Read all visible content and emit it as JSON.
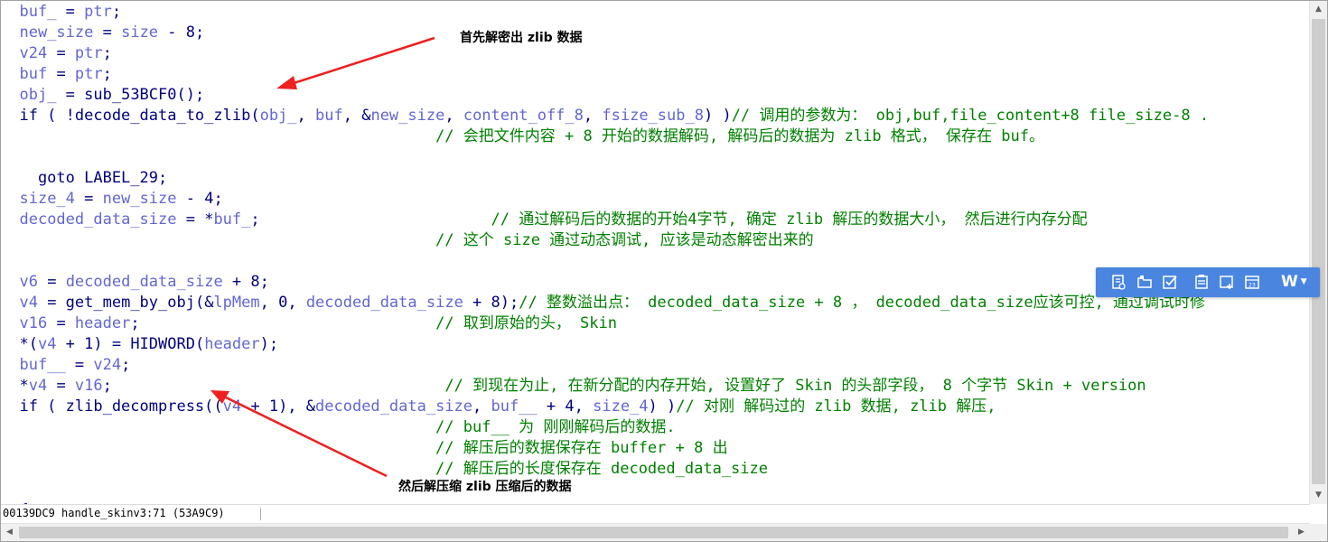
{
  "code_lines": [
    [
      {
        "t": "  "
      },
      {
        "t": "buf_",
        "c": "v"
      },
      {
        "t": " = "
      },
      {
        "t": "ptr",
        "c": "v"
      },
      {
        "t": ";"
      }
    ],
    [
      {
        "t": "  "
      },
      {
        "t": "new_size",
        "c": "v"
      },
      {
        "t": " = "
      },
      {
        "t": "size",
        "c": "v"
      },
      {
        "t": " - 8;"
      }
    ],
    [
      {
        "t": "  "
      },
      {
        "t": "v24",
        "c": "v"
      },
      {
        "t": " = "
      },
      {
        "t": "ptr",
        "c": "v"
      },
      {
        "t": ";"
      }
    ],
    [
      {
        "t": "  "
      },
      {
        "t": "buf",
        "c": "v"
      },
      {
        "t": " = "
      },
      {
        "t": "ptr",
        "c": "v"
      },
      {
        "t": ";"
      }
    ],
    [
      {
        "t": "  "
      },
      {
        "t": "obj_",
        "c": "v"
      },
      {
        "t": " = sub_53BCF0();"
      }
    ],
    [
      {
        "t": "  if ( !decode_data_to_zlib("
      },
      {
        "t": "obj_",
        "c": "v"
      },
      {
        "t": ", "
      },
      {
        "t": "buf",
        "c": "v"
      },
      {
        "t": ", &"
      },
      {
        "t": "new_size",
        "c": "v"
      },
      {
        "t": ", "
      },
      {
        "t": "content_off_8",
        "c": "v"
      },
      {
        "t": ", "
      },
      {
        "t": "fsize_sub_8",
        "c": "v"
      },
      {
        "t": ") )"
      },
      {
        "t": "// 调用的参数为： obj,buf,file_content+8 file_size-8 .",
        "c": "c"
      }
    ],
    [
      {
        "t": "                                               "
      },
      {
        "t": "// 会把文件内容 + 8 开始的数据解码, 解码后的数据为 zlib 格式， 保存在 buf。",
        "c": "c"
      }
    ],
    [
      {
        "t": ""
      }
    ],
    [
      {
        "t": "    goto LABEL_29;"
      }
    ],
    [
      {
        "t": "  "
      },
      {
        "t": "size_4",
        "c": "v"
      },
      {
        "t": " = "
      },
      {
        "t": "new_size",
        "c": "v"
      },
      {
        "t": " - 4;"
      }
    ],
    [
      {
        "t": "  "
      },
      {
        "t": "decoded_data_size",
        "c": "v"
      },
      {
        "t": " = *"
      },
      {
        "t": "buf_",
        "c": "v"
      },
      {
        "t": ";"
      },
      {
        "t": "                         "
      },
      {
        "t": "// 通过解码后的数据的开始4字节, 确定 zlib 解压的数据大小， 然后进行内存分配",
        "c": "c"
      }
    ],
    [
      {
        "t": "                                               "
      },
      {
        "t": "// 这个 size 通过动态调试, 应该是动态解密出来的",
        "c": "c"
      }
    ],
    [
      {
        "t": ""
      }
    ],
    [
      {
        "t": "  "
      },
      {
        "t": "v6",
        "c": "v"
      },
      {
        "t": " = "
      },
      {
        "t": "decoded_data_size",
        "c": "v"
      },
      {
        "t": " + 8;"
      }
    ],
    [
      {
        "t": "  "
      },
      {
        "t": "v4",
        "c": "v"
      },
      {
        "t": " = get_mem_by_obj(&"
      },
      {
        "t": "lpMem",
        "c": "v"
      },
      {
        "t": ", 0, "
      },
      {
        "t": "decoded_data_size",
        "c": "v"
      },
      {
        "t": " + 8);"
      },
      {
        "t": "// 整数溢出点： decoded_data_size + 8 ， decoded_data_size应该可控, 通过调试时修",
        "c": "c"
      }
    ],
    [
      {
        "t": "  "
      },
      {
        "t": "v16",
        "c": "v"
      },
      {
        "t": " = "
      },
      {
        "t": "header",
        "c": "v"
      },
      {
        "t": ";"
      },
      {
        "t": "                                "
      },
      {
        "t": "// 取到原始的头， Skin",
        "c": "c"
      }
    ],
    [
      {
        "t": "  *("
      },
      {
        "t": "v4",
        "c": "v"
      },
      {
        "t": " + 1) = HIDWORD("
      },
      {
        "t": "header",
        "c": "v"
      },
      {
        "t": ");"
      }
    ],
    [
      {
        "t": "  "
      },
      {
        "t": "buf__",
        "c": "v"
      },
      {
        "t": " = "
      },
      {
        "t": "v24",
        "c": "v"
      },
      {
        "t": ";"
      }
    ],
    [
      {
        "t": "  *"
      },
      {
        "t": "v4",
        "c": "v"
      },
      {
        "t": " = "
      },
      {
        "t": "v16",
        "c": "v"
      },
      {
        "t": ";"
      },
      {
        "t": "                                    "
      },
      {
        "t": "// 到现在为止, 在新分配的内存开始, 设置好了 Skin 的头部字段， 8 个字节 Skin + version",
        "c": "c"
      }
    ],
    [
      {
        "t": "  if ( zlib_decompress(("
      },
      {
        "t": "v4",
        "c": "v"
      },
      {
        "t": " + 1), &"
      },
      {
        "t": "decoded_data_size",
        "c": "v"
      },
      {
        "t": ", "
      },
      {
        "t": "buf__",
        "c": "v"
      },
      {
        "t": " + 4, "
      },
      {
        "t": "size_4",
        "c": "v"
      },
      {
        "t": ") )"
      },
      {
        "t": "// 对刚 解码过的 zlib 数据, zlib 解压,",
        "c": "c"
      }
    ],
    [
      {
        "t": "                                               "
      },
      {
        "t": "// buf__ 为 刚刚解码后的数据.",
        "c": "c"
      }
    ],
    [
      {
        "t": "                                               "
      },
      {
        "t": "// 解压后的数据保存在 buffer + 8 出",
        "c": "c"
      }
    ],
    [
      {
        "t": "                                               "
      },
      {
        "t": "// 解压后的长度保存在 decoded_data_size",
        "c": "c"
      }
    ],
    [
      {
        "t": ""
      }
    ],
    [
      {
        "t": "  {"
      }
    ],
    [
      {
        "t": "LABEL_29:"
      }
    ],
    [
      {
        "t": "    sub_482C20(&"
      },
      {
        "t": "obj",
        "c": "v"
      },
      {
        "t": ");"
      }
    ]
  ],
  "annotations": {
    "top": "首先解密出 zlib 数据",
    "bottom": "然后解压缩 zlib 压缩后的数据"
  },
  "status_bar": {
    "text": "00139DC9 handle_skinv3:71 (53A9C9)"
  },
  "floating_toolbar": {
    "icons": [
      "document-edit-icon",
      "folder-tag-icon",
      "checkbox-icon",
      "clipboard-list-icon",
      "image-add-icon",
      "calendar-icon"
    ],
    "brand_label": "W",
    "accent_color": "#4a86e0"
  },
  "colors": {
    "variable": "#6366d1",
    "keyword": "#000080",
    "comment": "#008000",
    "arrow": "#ee2020"
  }
}
